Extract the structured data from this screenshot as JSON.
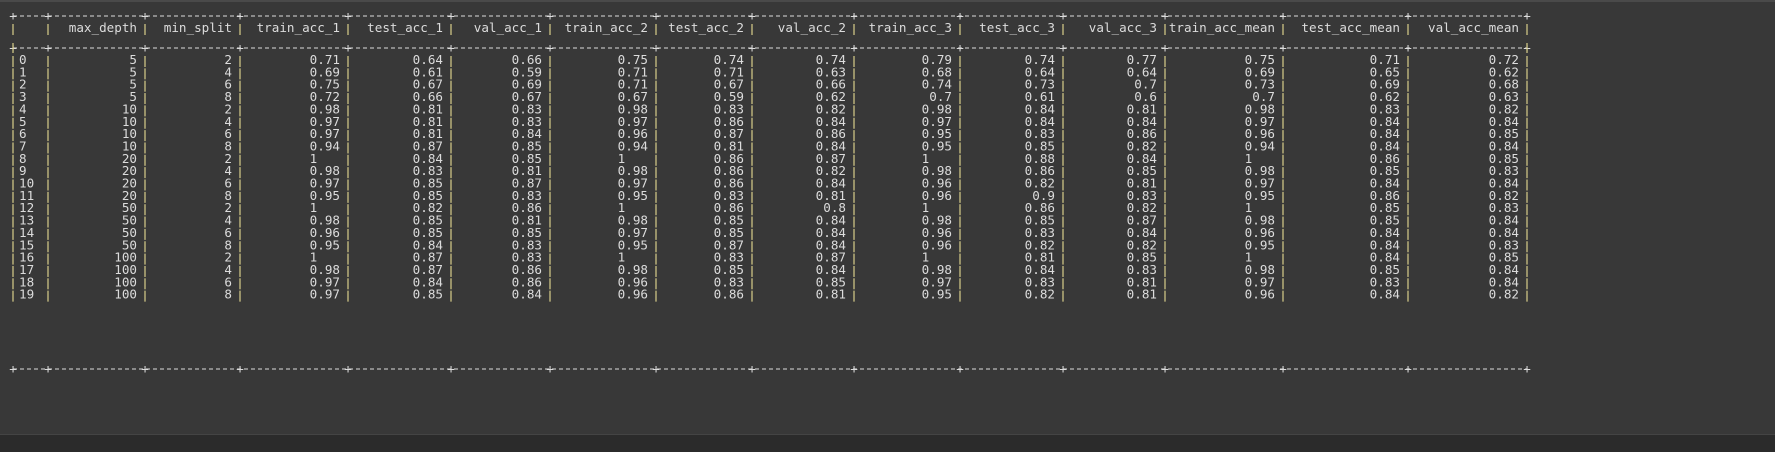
{
  "table": {
    "columns": [
      "",
      "max_depth",
      "min_split",
      "train_acc_1",
      "test_acc_1",
      "val_acc_1",
      "train_acc_2",
      "test_acc_2",
      "val_acc_2",
      "train_acc_3",
      "test_acc_3",
      "val_acc_3",
      "train_acc_mean",
      "test_acc_mean",
      "val_acc_mean"
    ],
    "rows": [
      [
        "0",
        "5",
        "2",
        "0.71",
        "0.64",
        "0.66",
        "0.75",
        "0.74",
        "0.74",
        "0.79",
        "0.74",
        "0.77",
        "0.75",
        "0.71",
        "0.72"
      ],
      [
        "1",
        "5",
        "4",
        "0.69",
        "0.61",
        "0.59",
        "0.71",
        "0.71",
        "0.63",
        "0.68",
        "0.64",
        "0.64",
        "0.69",
        "0.65",
        "0.62"
      ],
      [
        "2",
        "5",
        "6",
        "0.75",
        "0.67",
        "0.69",
        "0.71",
        "0.67",
        "0.66",
        "0.74",
        "0.73",
        "0.7",
        "0.73",
        "0.69",
        "0.68"
      ],
      [
        "3",
        "5",
        "8",
        "0.72",
        "0.66",
        "0.67",
        "0.67",
        "0.59",
        "0.62",
        "0.7",
        "0.61",
        "0.6",
        "0.7",
        "0.62",
        "0.63"
      ],
      [
        "4",
        "10",
        "2",
        "0.98",
        "0.81",
        "0.83",
        "0.98",
        "0.83",
        "0.82",
        "0.98",
        "0.84",
        "0.81",
        "0.98",
        "0.83",
        "0.82"
      ],
      [
        "5",
        "10",
        "4",
        "0.97",
        "0.81",
        "0.83",
        "0.97",
        "0.86",
        "0.84",
        "0.97",
        "0.84",
        "0.84",
        "0.97",
        "0.84",
        "0.84"
      ],
      [
        "6",
        "10",
        "6",
        "0.97",
        "0.81",
        "0.84",
        "0.96",
        "0.87",
        "0.86",
        "0.95",
        "0.83",
        "0.86",
        "0.96",
        "0.84",
        "0.85"
      ],
      [
        "7",
        "10",
        "8",
        "0.94",
        "0.87",
        "0.85",
        "0.94",
        "0.81",
        "0.84",
        "0.95",
        "0.85",
        "0.82",
        "0.94",
        "0.84",
        "0.84"
      ],
      [
        "8",
        "20",
        "2",
        "1",
        "0.84",
        "0.85",
        "1",
        "0.86",
        "0.87",
        "1",
        "0.88",
        "0.84",
        "1",
        "0.86",
        "0.85"
      ],
      [
        "9",
        "20",
        "4",
        "0.98",
        "0.83",
        "0.81",
        "0.98",
        "0.86",
        "0.82",
        "0.98",
        "0.86",
        "0.85",
        "0.98",
        "0.85",
        "0.83"
      ],
      [
        "10",
        "20",
        "6",
        "0.97",
        "0.85",
        "0.87",
        "0.97",
        "0.86",
        "0.84",
        "0.96",
        "0.82",
        "0.81",
        "0.97",
        "0.84",
        "0.84"
      ],
      [
        "11",
        "20",
        "8",
        "0.95",
        "0.85",
        "0.83",
        "0.95",
        "0.83",
        "0.81",
        "0.96",
        "0.9",
        "0.83",
        "0.95",
        "0.86",
        "0.82"
      ],
      [
        "12",
        "50",
        "2",
        "1",
        "0.82",
        "0.86",
        "1",
        "0.86",
        "0.8",
        "1",
        "0.86",
        "0.82",
        "1",
        "0.85",
        "0.83"
      ],
      [
        "13",
        "50",
        "4",
        "0.98",
        "0.85",
        "0.81",
        "0.98",
        "0.85",
        "0.84",
        "0.98",
        "0.85",
        "0.87",
        "0.98",
        "0.85",
        "0.84"
      ],
      [
        "14",
        "50",
        "6",
        "0.96",
        "0.85",
        "0.85",
        "0.97",
        "0.85",
        "0.84",
        "0.96",
        "0.83",
        "0.84",
        "0.96",
        "0.84",
        "0.84"
      ],
      [
        "15",
        "50",
        "8",
        "0.95",
        "0.84",
        "0.83",
        "0.95",
        "0.87",
        "0.84",
        "0.96",
        "0.82",
        "0.82",
        "0.95",
        "0.84",
        "0.83"
      ],
      [
        "16",
        "100",
        "2",
        "1",
        "0.87",
        "0.83",
        "1",
        "0.83",
        "0.87",
        "1",
        "0.81",
        "0.85",
        "1",
        "0.84",
        "0.85"
      ],
      [
        "17",
        "100",
        "4",
        "0.98",
        "0.87",
        "0.86",
        "0.98",
        "0.85",
        "0.84",
        "0.98",
        "0.84",
        "0.83",
        "0.98",
        "0.85",
        "0.84"
      ],
      [
        "18",
        "100",
        "6",
        "0.97",
        "0.84",
        "0.86",
        "0.96",
        "0.83",
        "0.85",
        "0.97",
        "0.83",
        "0.81",
        "0.97",
        "0.83",
        "0.84"
      ],
      [
        "19",
        "100",
        "8",
        "0.97",
        "0.85",
        "0.84",
        "0.96",
        "0.86",
        "0.81",
        "0.95",
        "0.82",
        "0.81",
        "0.96",
        "0.84",
        "0.82"
      ]
    ]
  },
  "colors": {
    "background": "#383838",
    "text": "#dcdcdc",
    "pipe": "#d9cf8a",
    "bottom_strip": "#2b2b2b"
  }
}
